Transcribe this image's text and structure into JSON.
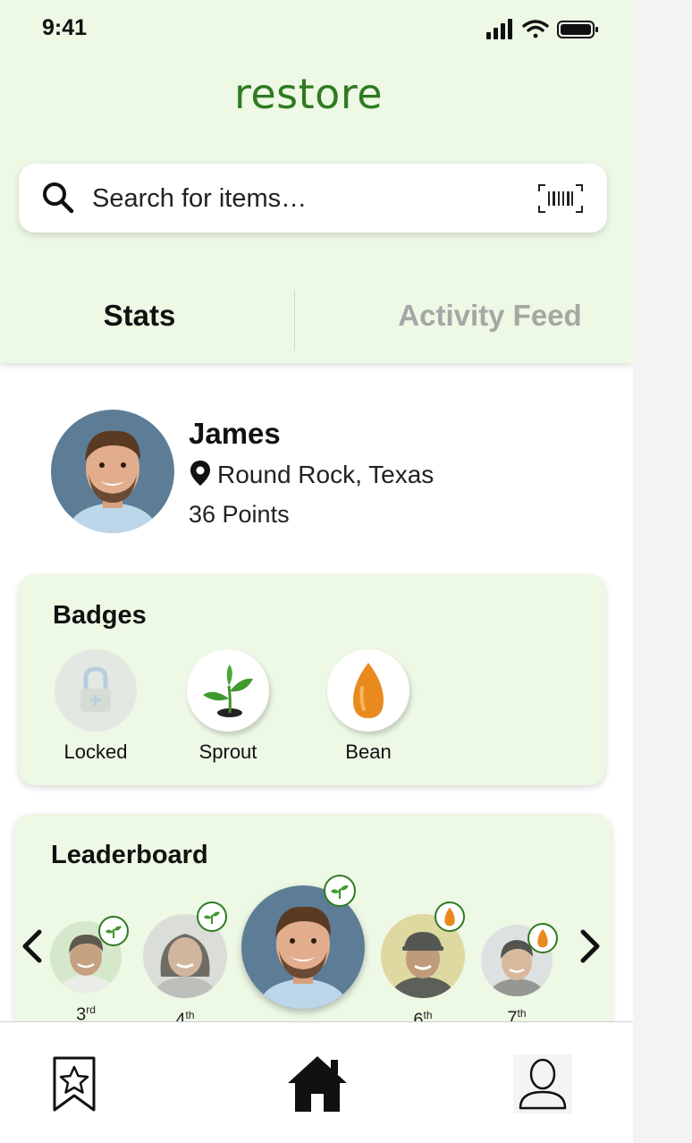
{
  "status_bar": {
    "time": "9:41",
    "icons": [
      "signal-icon",
      "wifi-icon",
      "battery-icon"
    ]
  },
  "app": {
    "title": "restore",
    "brand_color": "#2f7a22",
    "bg_color": "#edf8e5"
  },
  "search": {
    "placeholder": "Search for items…",
    "scan_icon": "barcode-scan-icon"
  },
  "tabs": [
    {
      "label": "Stats",
      "active": true
    },
    {
      "label": "Activity Feed",
      "active": false
    }
  ],
  "profile": {
    "name": "James",
    "location": "Round Rock, Texas",
    "points": "36 Points"
  },
  "badges": {
    "title": "Badges",
    "items": [
      {
        "label": "Locked",
        "icon": "lock-icon"
      },
      {
        "label": "Sprout",
        "icon": "sprout-icon"
      },
      {
        "label": "Bean",
        "icon": "bean-icon"
      }
    ]
  },
  "leaderboard": {
    "title": "Leaderboard",
    "entries": [
      {
        "rank": "3",
        "suffix": "rd",
        "badge": "sprout-icon"
      },
      {
        "rank": "4",
        "suffix": "th",
        "badge": "sprout-icon"
      },
      {
        "rank": "",
        "suffix": "",
        "badge": "sprout-icon"
      },
      {
        "rank": "6",
        "suffix": "th",
        "badge": "bean-icon"
      },
      {
        "rank": "7",
        "suffix": "th",
        "badge": "bean-icon"
      }
    ]
  },
  "bottom_nav": [
    {
      "name": "saved",
      "icon": "bookmark-star-icon"
    },
    {
      "name": "home",
      "icon": "home-icon",
      "active": true
    },
    {
      "name": "profile",
      "icon": "user-icon"
    }
  ]
}
